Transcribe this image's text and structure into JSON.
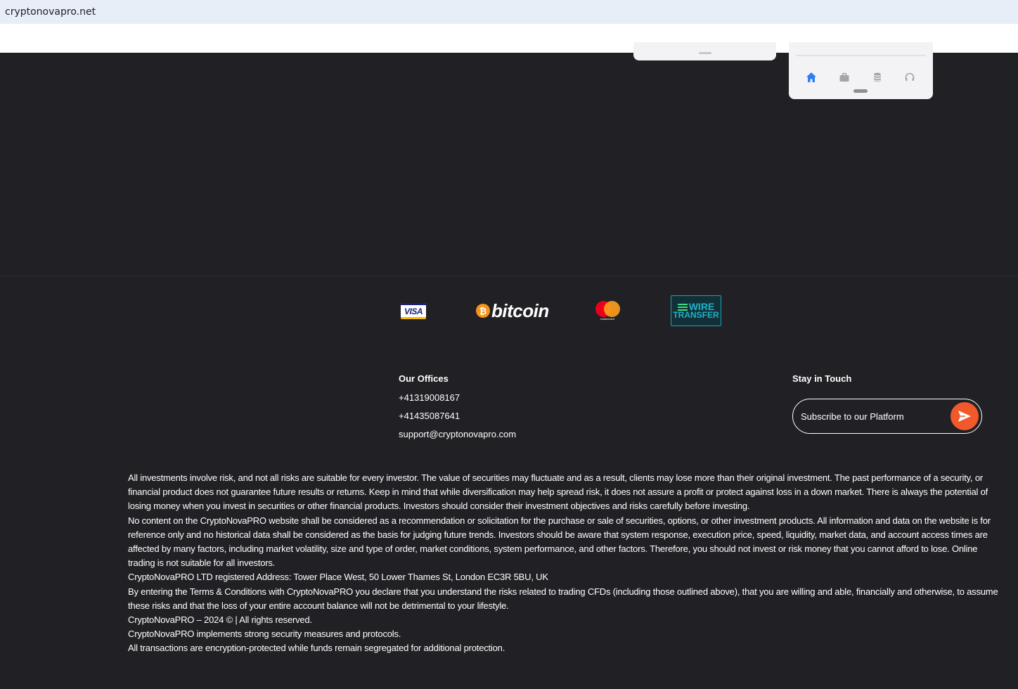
{
  "browser": {
    "url": "cryptonovapro.net"
  },
  "app_preview": {
    "nav_icons": [
      "home-icon",
      "briefcase-icon",
      "database-icon",
      "headset-icon"
    ],
    "active_icon": "home-icon"
  },
  "payments": {
    "visa_label": "VISA",
    "bitcoin_symbol": "₿",
    "bitcoin_label": "bitcoin",
    "mastercard_label": "mastercard",
    "wire_line1": "WIRE",
    "wire_line2": "TRANSFER"
  },
  "offices": {
    "heading": "Our Offices",
    "phone1": "+41319008167",
    "phone2": "+41435087641",
    "email": "support@cryptonovapro.com"
  },
  "stay_in_touch": {
    "heading": "Stay in Touch",
    "placeholder": "Subscribe to our Platform"
  },
  "disclaimer": [
    "All investments involve risk, and not all risks are suitable for every investor. The value of securities may fluctuate and as a result, clients may lose more than their original investment. The past performance of a security, or financial product does not guarantee future results or returns. Keep in mind that while diversification may help spread risk, it does not assure a profit or protect against loss in a down market. There is always the potential of losing money when you invest in securities or other financial products. Investors should consider their investment objectives and risks carefully before investing.",
    "No content on the CryptoNovaPRO website shall be considered as a recommendation or solicitation for the purchase or sale of securities, options, or other investment products. All information and data on the website is for reference only and no historical data shall be considered as the basis for judging future trends. Investors should be aware that system response, execution price, speed, liquidity, market data, and account access times are affected by many factors, including market volatility, size and type of order, market conditions, system performance, and other factors. Therefore, you should not invest or risk money that you cannot afford to lose. Online trading is not suitable for all investors.",
    "CryptoNovaPRO LTD registered Address: Tower Place West, 50 Lower Thames St, London EC3R 5BU, UK",
    "By entering the Terms & Conditions with CryptoNovaPRO you declare that you understand the risks related to trading CFDs (including those outlined above), that you are willing and able, financially and otherwise, to assume these risks and that the loss of your entire account balance will not be detrimental to your lifestyle.",
    "CryptoNovaPRO – 2024 © | All rights reserved.",
    "CryptoNovaPRO implements strong security measures and protocols.",
    "All transactions are encryption-protected while funds remain segregated for additional protection."
  ],
  "colors": {
    "background": "#212024",
    "accent": "#f1592a",
    "active_nav": "#2b7ff5"
  }
}
